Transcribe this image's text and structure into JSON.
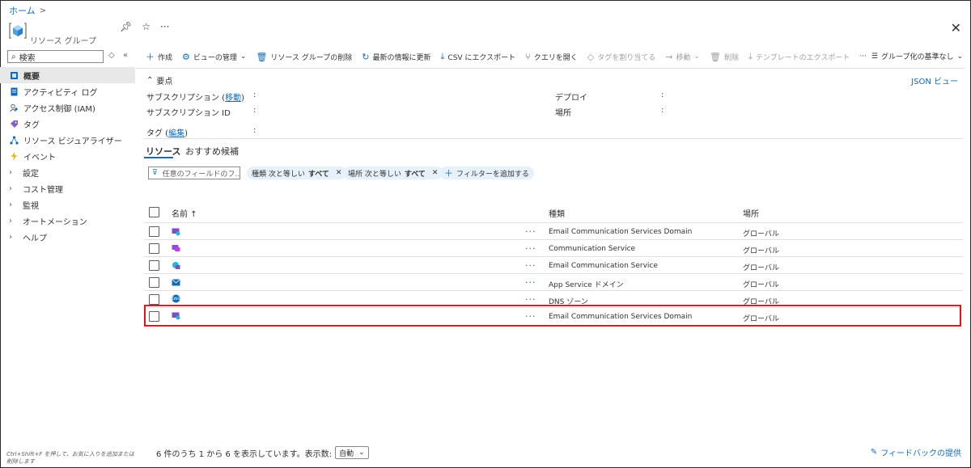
{
  "breadcrumb": {
    "home": "ホーム"
  },
  "header": {
    "resource_type": "リソース グループ",
    "close_label": "✕"
  },
  "sidebar": {
    "search_placeholder": "検索",
    "items": [
      {
        "label": "概要",
        "icon": "overview-icon",
        "active": true
      },
      {
        "label": "アクティビティ ログ",
        "icon": "activity-log-icon"
      },
      {
        "label": "アクセス制御 (IAM)",
        "icon": "iam-icon"
      },
      {
        "label": "タグ",
        "icon": "tag-icon"
      },
      {
        "label": "リソース ビジュアライザー",
        "icon": "visualizer-icon"
      },
      {
        "label": "イベント",
        "icon": "event-icon"
      },
      {
        "label": "設定",
        "expandable": true
      },
      {
        "label": "コスト管理",
        "expandable": true
      },
      {
        "label": "監視",
        "expandable": true
      },
      {
        "label": "オートメーション",
        "expandable": true
      },
      {
        "label": "ヘルプ",
        "expandable": true
      }
    ],
    "keyboard_hint": "Ctrl+Shift+F を押して、お気に入りを追加または削除します"
  },
  "toolbar": {
    "create": "作成",
    "manage_view": "ビューの管理",
    "delete_rg": "リソース グループの削除",
    "refresh": "最新の情報に更新",
    "export_csv": "CSV にエクスポート",
    "open_query": "クエリを開く",
    "assign_tags": "タグを割り当てる",
    "move": "移動",
    "delete": "削除",
    "export_template": "テンプレートのエクスポート",
    "more": "···",
    "group_by": "グループ化の基準なし"
  },
  "essentials": {
    "heading": "要点",
    "json_view": "JSON ビュー",
    "subscription_label": "サブスクリプション",
    "subscription_link": "移動",
    "subscription_id_label": "サブスクリプション ID",
    "tags_label": "タグ",
    "tags_link": "編集",
    "deploy_label": "デプロイ",
    "location_label": "場所",
    "colon": ":"
  },
  "tabs": {
    "resources": "リソース",
    "recommendations": "おすすめ候補"
  },
  "filters": {
    "search_placeholder": "任意のフィールドのフ...",
    "type_filter": {
      "field": "種類 次と等しい",
      "value": "すべて"
    },
    "location_filter": {
      "field": "場所 次と等しい",
      "value": "すべて"
    },
    "add_filter": "フィルターを追加する"
  },
  "table": {
    "headers": {
      "name": "名前 ↑",
      "type": "種類",
      "location": "場所"
    },
    "rows": [
      {
        "type": "Email Communication Services Domain",
        "location": "グローバル",
        "icon_color": "#7a52c7"
      },
      {
        "type": "Communication Service",
        "location": "グローバル",
        "icon_color": "#8a4be0"
      },
      {
        "type": "Email Communication Service",
        "location": "グローバル",
        "icon_color": "#2bb5d8"
      },
      {
        "type": "App Service ドメイン",
        "location": "グローバル",
        "icon_color": "#0f6cbd"
      },
      {
        "type": "DNS ゾーン",
        "location": "グローバル",
        "icon_color": "#0f6cbd"
      },
      {
        "type": "Email Communication Services Domain",
        "location": "グローバル",
        "icon_color": "#7a52c7"
      }
    ],
    "row_menu": "···"
  },
  "footer": {
    "paging_text": "6 件のうち 1 から 6 を表示しています。表示数:",
    "page_size": "自動",
    "feedback": "フィードバックの提供"
  }
}
